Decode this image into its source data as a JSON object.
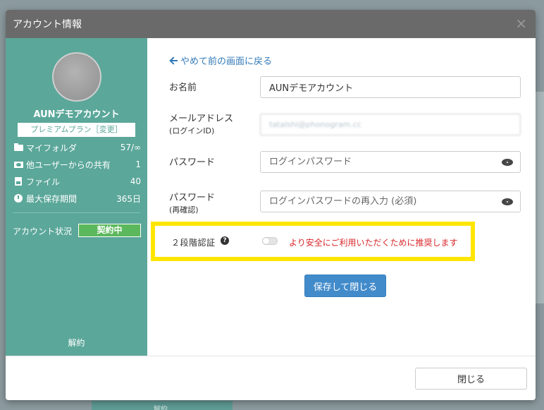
{
  "modal": {
    "title": "アカウント情報",
    "close_glyph": "×"
  },
  "sidebar": {
    "account_name": "AUNデモアカウント",
    "plan": "プレミアムプラン［変更］",
    "stats": [
      {
        "icon": "folder-icon",
        "label": "マイフォルダ",
        "value": "57/∞"
      },
      {
        "icon": "shared-folder-icon",
        "label": "他ユーザーからの共有",
        "value": "1"
      },
      {
        "icon": "file-icon",
        "label": "ファイル",
        "value": "40"
      },
      {
        "icon": "clock-icon",
        "label": "最大保存期間",
        "value": "365日"
      }
    ],
    "status_label": "アカウント状況",
    "status_value": "契約中",
    "cancel_label": "解約"
  },
  "form": {
    "back_label": "やめて前の画面に戻る",
    "name_label": "お名前",
    "name_value": "AUNデモアカウント",
    "email_label": "メールアドレス",
    "email_sublabel": "(ログインID)",
    "email_value": "tatalshi@phonogram.cc",
    "password_label": "パスワード",
    "password_placeholder": "ログインパスワード",
    "password_confirm_label": "パスワード",
    "password_confirm_sublabel": "(再確認)",
    "password_confirm_placeholder": "ログインパスワードの再入力 (必須)",
    "two_factor_label": "２段階認証",
    "two_factor_enabled": false,
    "two_factor_note": "より安全にご利用いただくために推奨します",
    "save_label": "保存して閉じる"
  },
  "footer": {
    "close_label": "閉じる"
  },
  "background": {
    "hint_text": "解約"
  },
  "colors": {
    "sidebar": "#5ba79a",
    "primary": "#428bca",
    "status_badge": "#5cb85c",
    "highlight": "#ffe600",
    "warning_text": "#d9262b"
  }
}
